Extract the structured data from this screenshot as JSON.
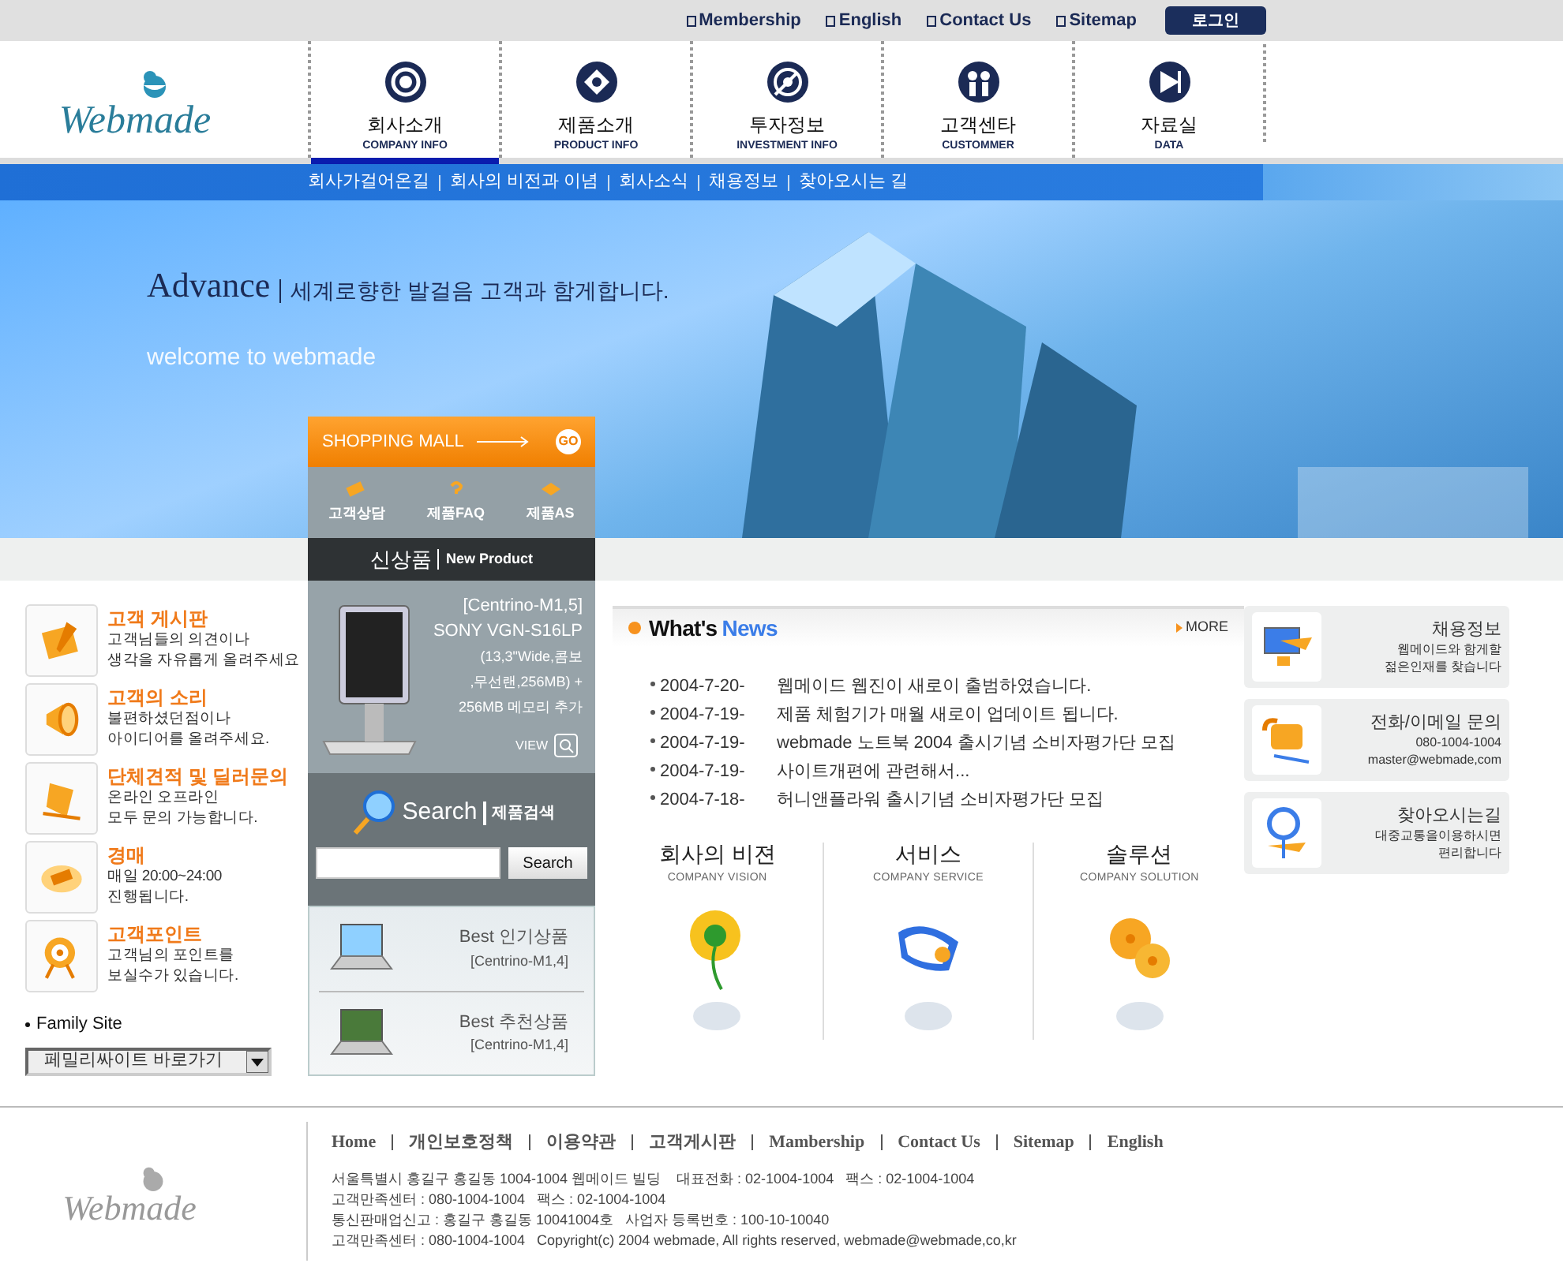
{
  "top_links": [
    {
      "label": "Membership"
    },
    {
      "label": "English"
    },
    {
      "label": "Contact Us"
    },
    {
      "label": "Sitemap"
    }
  ],
  "login_button": "로그인",
  "logo": "Webmade",
  "nav": [
    {
      "label": "회사소개",
      "sublabel": "COMPANY INFO",
      "selected": true
    },
    {
      "label": "제품소개",
      "sublabel": "PRODUCT INFO",
      "selected": false
    },
    {
      "label": "투자정보",
      "sublabel": "INVESTMENT INFO",
      "selected": false
    },
    {
      "label": "고객센타",
      "sublabel": "CUSTOMMER",
      "selected": false
    },
    {
      "label": "자료실",
      "sublabel": "DATA",
      "selected": false
    }
  ],
  "subnav": [
    "회사가걸어온길",
    "회사의 비전과 이념",
    "회사소식",
    "채용정보",
    "찾아오시는 길"
  ],
  "banner": {
    "title": "Advance",
    "tagline": "세계로향한 발걸음 고객과 함게합니다.",
    "welcome": "welcome to webmade"
  },
  "shopping_mall": {
    "label": "SHOPPING MALL",
    "go": "GO",
    "links": [
      "고객상담",
      "제품FAQ",
      "제품AS"
    ]
  },
  "new_product": {
    "title": "신상품",
    "subtitle": "New Product",
    "lines": [
      "[Centrino-M1,5]",
      "SONY VGN-S16LP",
      "(13,3\"Wide,콤보",
      ",무선랜,256MB) +",
      "256MB 메모리 추가"
    ],
    "view": "VIEW"
  },
  "search": {
    "title": "Search",
    "subtitle": "제품검색",
    "button": "Search"
  },
  "best": [
    {
      "title": "Best 인기상품",
      "model": "[Centrino-M1,4]"
    },
    {
      "title": "Best 추천상품",
      "model": "[Centrino-M1,4]"
    }
  ],
  "customer_links": [
    {
      "title": "고객 게시판",
      "lines": [
        "고객님들의 의견이나",
        "생각을 자유롭게 올려주세요"
      ]
    },
    {
      "title": "고객의 소리",
      "lines": [
        "불편하셨던점이나",
        "아이디어를 올려주세요."
      ]
    },
    {
      "title": "단체견적 및 딜러문의",
      "lines": [
        "온라인 오프라인",
        "모두 문의 가능합니다."
      ]
    },
    {
      "title": "경매",
      "lines": [
        "매일 20:00~24:00",
        "진행됩니다."
      ]
    },
    {
      "title": "고객포인트",
      "lines": [
        "고객님의 포인트를",
        "보실수가 있습니다."
      ]
    }
  ],
  "family_site": {
    "label": "Family Site",
    "select": "페밀리싸이트 바로가기"
  },
  "news": {
    "title_1": "What's",
    "title_2": "News",
    "more": "MORE",
    "items": [
      {
        "date": "2004-7-20-",
        "text": "웹메이드 웹진이 새로이 출범하였습니다."
      },
      {
        "date": "2004-7-19-",
        "text": "제품 체험기가 매월 새로이 업데이트 됩니다."
      },
      {
        "date": "2004-7-19-",
        "text": "webmade 노트북 2004  출시기념 소비자평가단 모집"
      },
      {
        "date": "2004-7-19-",
        "text": "사이트개편에 관련해서..."
      },
      {
        "date": "2004-7-18-",
        "text": "허니앤플라워 출시기념 소비자평가단 모집"
      }
    ]
  },
  "services": [
    {
      "title": "회사의 비젼",
      "subtitle": "COMPANY VISION"
    },
    {
      "title": "서비스",
      "subtitle": "COMPANY SERVICE"
    },
    {
      "title": "솔루션",
      "subtitle": "COMPANY SOLUTION"
    }
  ],
  "info_cards": [
    {
      "title": "채용정보",
      "lines": [
        "웹메이드와 함게할",
        "젊은인재를 찾습니다"
      ]
    },
    {
      "title": "전화/이메일 문의",
      "lines": [
        "080-1004-1004",
        "master@webmade,com"
      ]
    },
    {
      "title": "찾아오시는길",
      "lines": [
        "대중교통을이용하시면",
        "편리합니다"
      ]
    }
  ],
  "footer": {
    "logo": "Webmade",
    "links": [
      "Home",
      "개인보호정책",
      "이용약관",
      "고객게시판",
      "Mambership",
      "Contact Us",
      "Sitemap",
      "English"
    ],
    "lines": [
      "서울특별시 홍길구 홍길동 1004-1004 웹메이드 빌딩    대표전화 : 02-1004-1004   팩스 : 02-1004-1004",
      "고객만족센터 : 080-1004-1004   팩스 : 02-1004-1004",
      "통신판매업신고 : 홍길구 홍길동 10041004호   사업자 등록번호 : 100-10-10040",
      "고객만족센터 : 080-1004-1004   Copyright(c) 2004 webmade, All rights reserved, webmade@webmade,co,kr"
    ]
  }
}
